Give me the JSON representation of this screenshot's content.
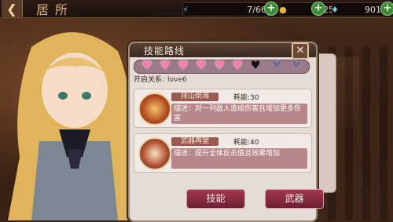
{
  "header": {
    "title": "居所",
    "back_icon": "back-arrow-icon",
    "resources": [
      {
        "icon": "lightning-icon",
        "value": "7/66",
        "color": "#5fb0e0"
      },
      {
        "icon": "gold-coin-icon",
        "value": "253191",
        "color": "#e2b83a"
      },
      {
        "icon": "gem-icon",
        "value": "901",
        "color": "#7ac0f0"
      }
    ]
  },
  "panel": {
    "title": "技能路线",
    "relation_label": "开启关系:",
    "relation_value": "love6",
    "hearts": [
      {
        "state": "pink"
      },
      {
        "state": "pink"
      },
      {
        "state": "pink"
      },
      {
        "state": "pink"
      },
      {
        "state": "pink"
      },
      {
        "state": "pink"
      },
      {
        "state": "dark"
      },
      {
        "state": "locked"
      },
      {
        "state": "locked"
      }
    ],
    "skills": [
      {
        "name": "排山倒海",
        "cd_label": "耗能",
        "cd_value": ":30",
        "desc": "描述：对一列敌人造成伤害且增加更多伤害"
      },
      {
        "name": "武器再塑",
        "cd_label": "耗能",
        "cd_value": ":40",
        "desc": "描述：提升全体反击值且效果增加"
      }
    ]
  },
  "buttons": {
    "skill": "技能",
    "weapon": "武器"
  },
  "colors": {
    "accent": "#a3384f",
    "heart": "#ff7ab0"
  }
}
